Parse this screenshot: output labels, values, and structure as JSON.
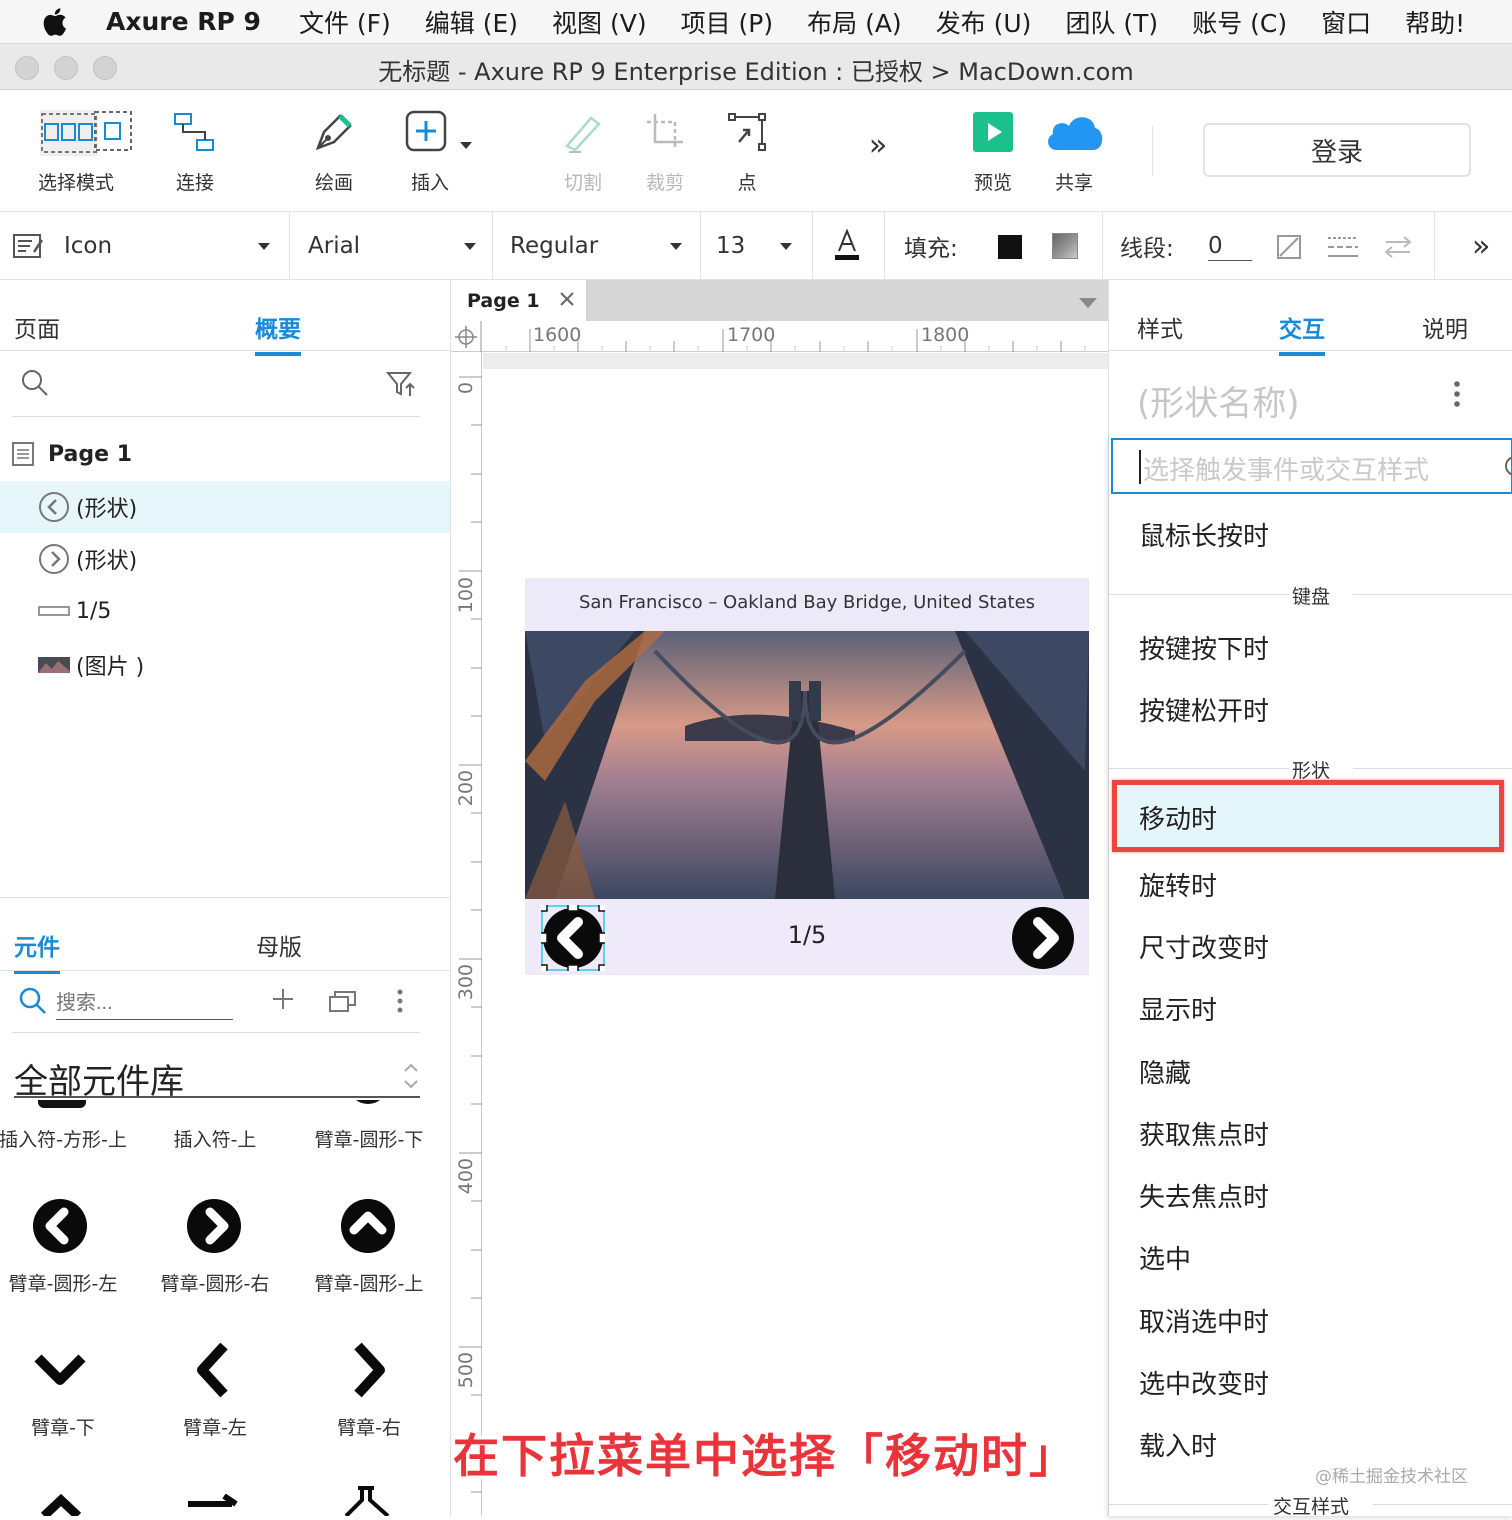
{
  "menubar": {
    "app": "Axure RP 9",
    "items": [
      "文件 (F)",
      "编辑 (E)",
      "视图 (V)",
      "项目 (P)",
      "布局 (A)",
      "发布 (U)",
      "团队 (T)",
      "账号 (C)",
      "窗口",
      "帮助!"
    ]
  },
  "window": {
    "title": "无标题 - Axure RP 9 Enterprise Edition : 已授权 > MacDown.com"
  },
  "toolbar": {
    "select_mode": "选择模式",
    "connect": "连接",
    "draw": "绘画",
    "insert": "插入",
    "slice": "切割",
    "crop": "裁剪",
    "point": "点",
    "more": "»",
    "preview": "预览",
    "share": "共享",
    "login": "登录",
    "preview_color": "#1cc08a",
    "share_color": "#2196f3"
  },
  "format": {
    "style_name": "Icon",
    "font": "Arial",
    "weight": "Regular",
    "size": "13",
    "fill_label": "填充:",
    "line_label": "线段:",
    "line_value": "0",
    "more": "»"
  },
  "left": {
    "tabs": [
      "页面",
      "概要"
    ],
    "page_name": "Page 1",
    "outline": [
      {
        "label": "(形状)",
        "icon": "arrow-left-circle-icon",
        "selected": true
      },
      {
        "label": "(形状)",
        "icon": "arrow-right-circle-icon",
        "selected": false
      },
      {
        "label": "1/5",
        "icon": "text-field-icon",
        "selected": false
      },
      {
        "label": "(图片 )",
        "icon": "image-thumbnail-icon",
        "selected": false
      }
    ],
    "lib_tabs": [
      "元件",
      "母版"
    ],
    "search_placeholder": "搜索...",
    "library": "全部元件库",
    "widgets_row0": [
      "插入符-方形-上",
      "插入符-上",
      "臂章-圆形-下"
    ],
    "widgets_row1": [
      "臂章-圆形-左",
      "臂章-圆形-右",
      "臂章-圆形-上"
    ],
    "widgets_row2": [
      "臂章-下",
      "臂章-左",
      "臂章-右"
    ]
  },
  "canvas": {
    "tab": "Page 1",
    "ruler_h": [
      "1600",
      "1700",
      "1800"
    ],
    "ruler_v": [
      "0",
      "100",
      "200",
      "300",
      "400",
      "500"
    ],
    "slide_caption": "San Francisco – Oakland Bay Bridge, United States",
    "counter": "1/5"
  },
  "right": {
    "tabs": [
      "样式",
      "交互",
      "说明"
    ],
    "shape_name": "(形状名称)",
    "search_placeholder": "选择触发事件或交互样式",
    "event_long_press": "鼠标长按时",
    "section_keyboard": "键盘",
    "event_key_down": "按键按下时",
    "event_key_up": "按键松开时",
    "section_shape": "形状",
    "event_moved": "移动时",
    "events_rest": [
      "旋转时",
      "尺寸改变时",
      "显示时",
      "隐藏",
      "获取焦点时",
      "失去焦点时",
      "选中",
      "取消选中时",
      "选中改变时",
      "载入时"
    ],
    "section_interaction_style": "交互样式",
    "highlight_color": "#e9473f"
  },
  "caption": "在下拉菜单中选择「移动时」",
  "watermark": "@稀土掘金技术社区"
}
